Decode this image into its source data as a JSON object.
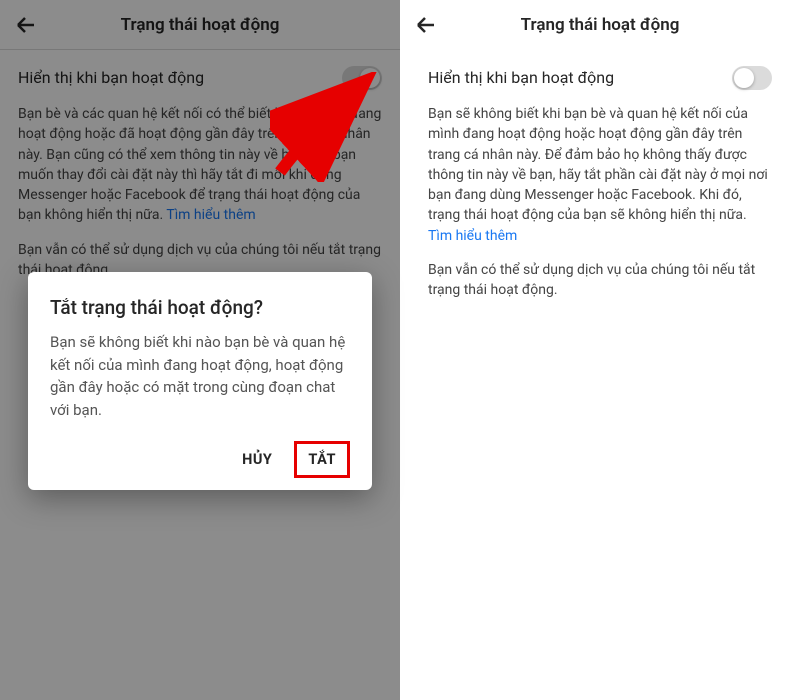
{
  "left": {
    "header_title": "Trạng thái hoạt động",
    "setting_label": "Hiển thị khi bạn hoạt động",
    "desc": "Bạn bè và các quan hệ kết nối có thể biết khi nào bạn đang hoạt động hoặc đã hoạt động gần đây trên trang cá nhân này. Bạn cũng có thể xem thông tin này về họ. Nếu bạn muốn thay đổi cài đặt này thì hãy tắt đi mỗi khi dùng Messenger hoặc Facebook để trạng thái hoạt động của bạn không hiển thị nữa. ",
    "link": "Tìm hiểu thêm",
    "desc2": "Bạn vẫn có thể sử dụng dịch vụ của chúng tôi nếu tắt trạng thái hoạt động.",
    "dialog_title": "Tắt trạng thái hoạt động?",
    "dialog_body": "Bạn sẽ không biết khi nào bạn bè và quan hệ kết nối của mình đang hoạt động, hoạt động gần đây hoặc có mặt trong cùng đoạn chat với bạn.",
    "dialog_cancel": "HỦY",
    "dialog_confirm": "TẮT"
  },
  "right": {
    "header_title": "Trạng thái hoạt động",
    "setting_label": "Hiển thị khi bạn hoạt động",
    "desc": "Bạn sẽ không biết khi bạn bè và quan hệ kết nối của mình đang hoạt động hoặc hoạt động gần đây trên trang cá nhân này. Để đảm bảo họ không thấy được thông tin này về bạn, hãy tắt phần cài đặt này ở mọi nơi bạn đang dùng Messenger hoặc Facebook. Khi đó, trạng thái hoạt động của bạn sẽ không hiển thị nữa. ",
    "link": "Tìm hiểu thêm",
    "desc2": "Bạn vẫn có thể sử dụng dịch vụ của chúng tôi nếu tắt trạng thái hoạt động."
  }
}
